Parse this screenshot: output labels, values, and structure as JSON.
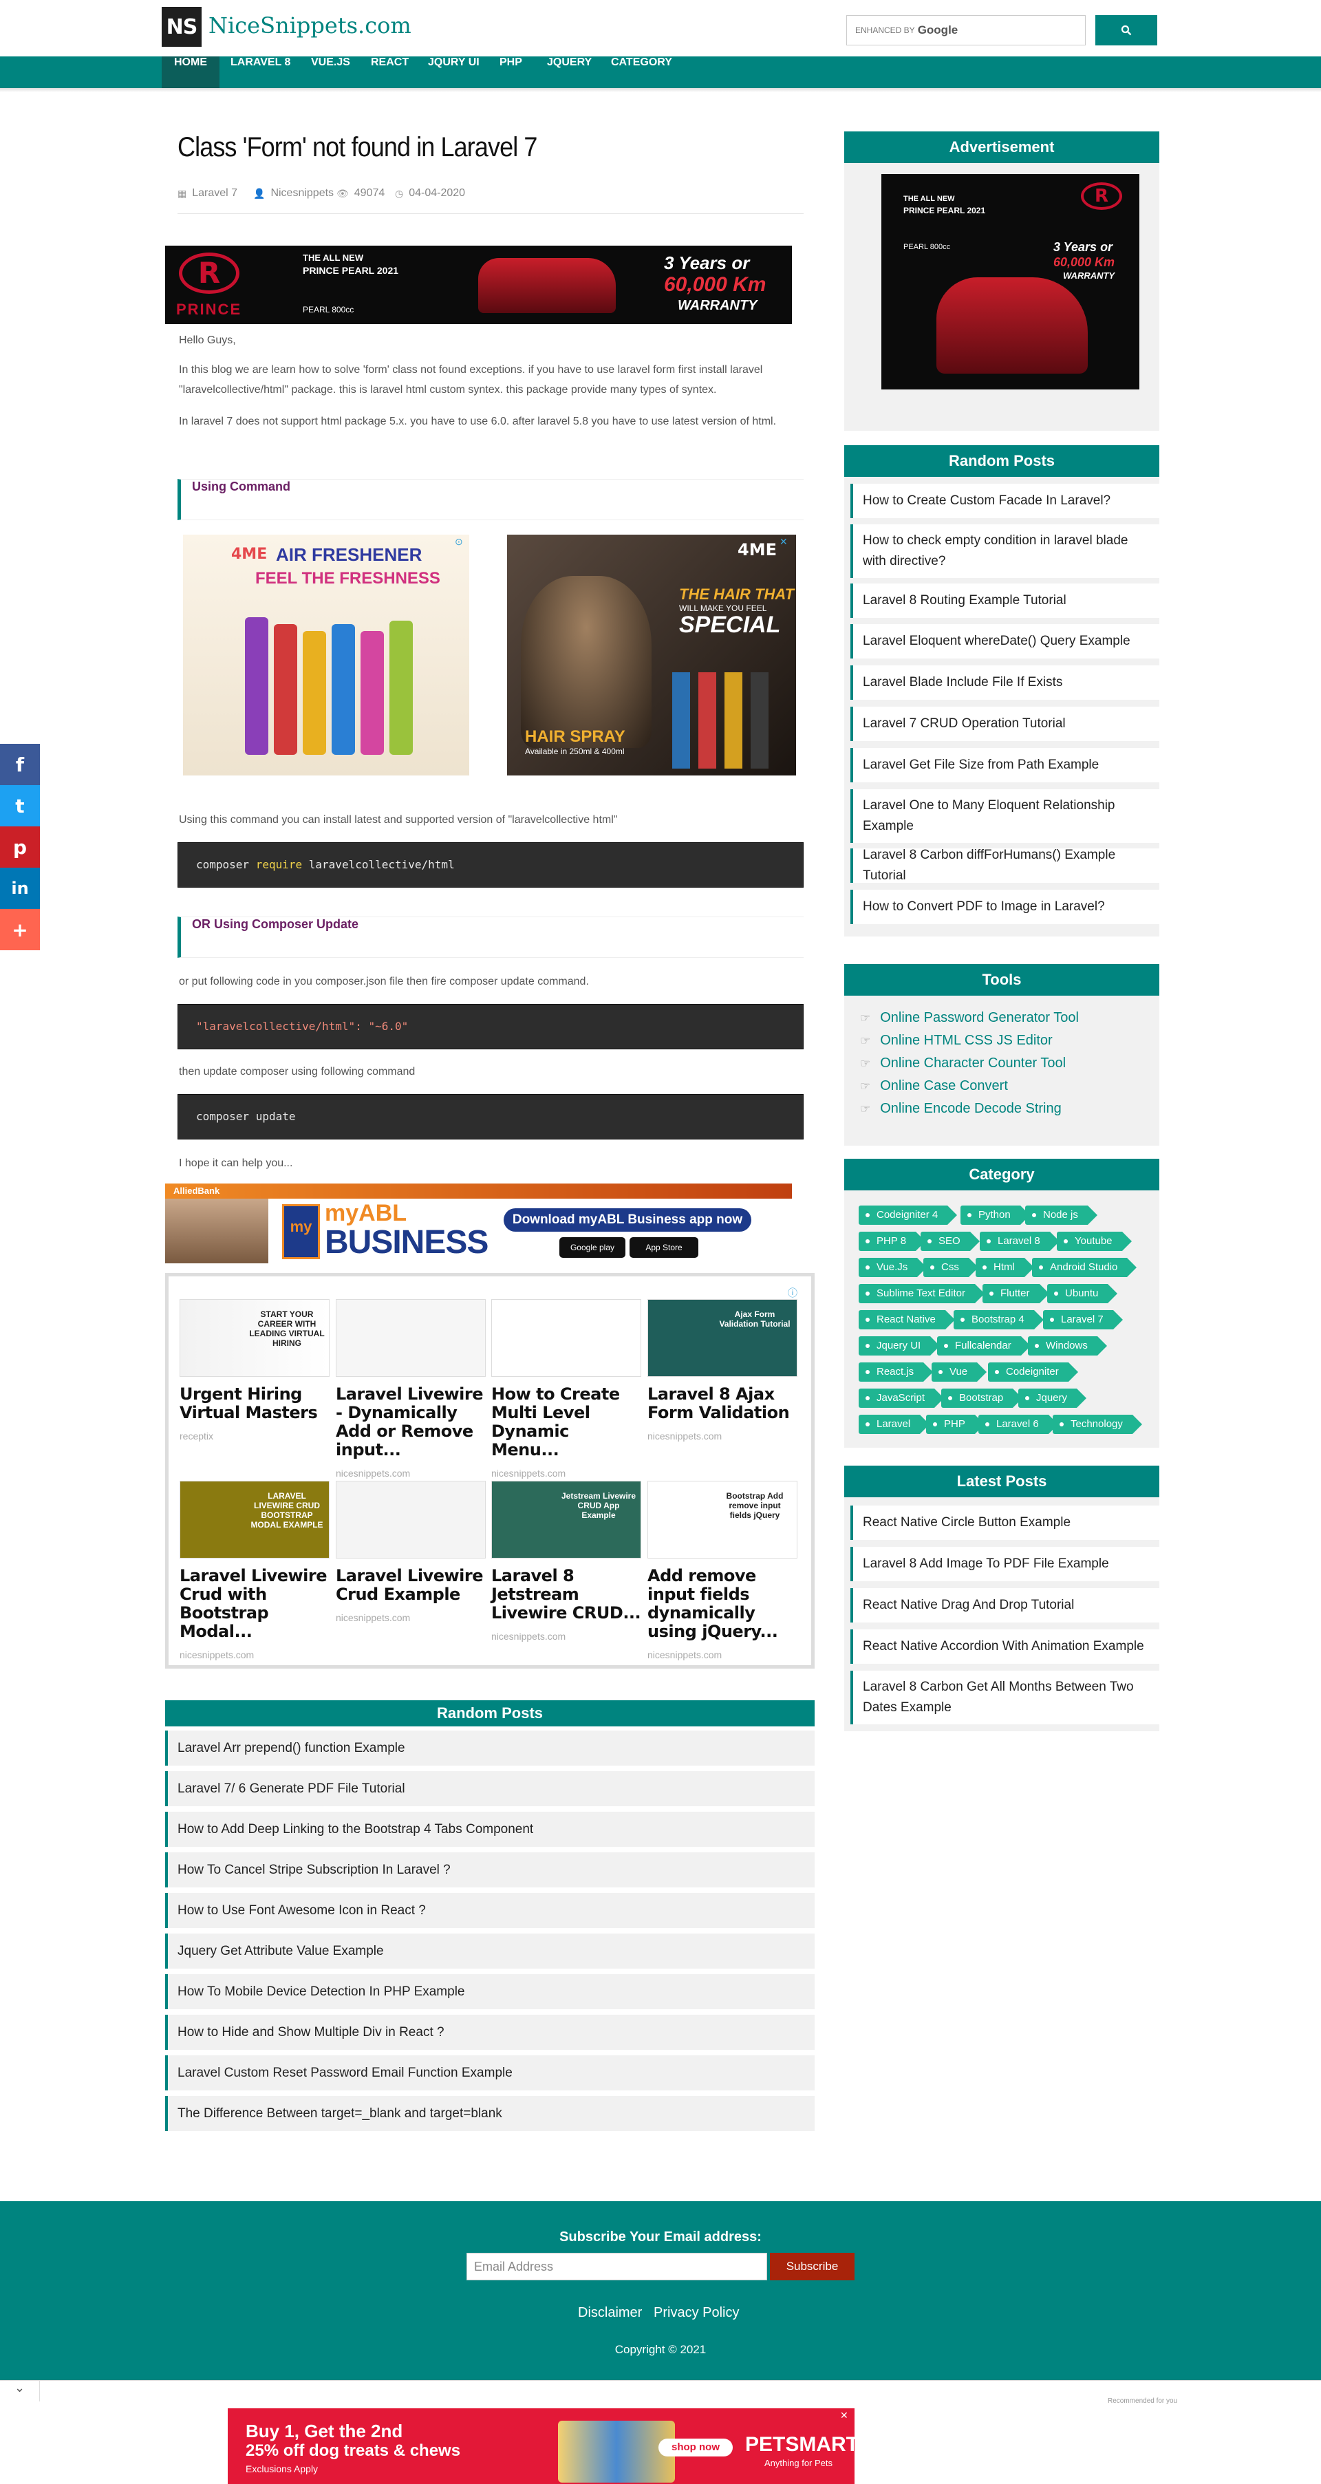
{
  "header": {
    "logo_mark": "NS",
    "site_name": "NiceSnippets.com",
    "search_prefix": "ENHANCED BY",
    "search_brand": "Google"
  },
  "nav": [
    "HOME",
    "LARAVEL 8",
    "VUE.JS",
    "REACT",
    "JQURY UI",
    "PHP",
    "JQUERY",
    "CATEGORY"
  ],
  "article": {
    "title": "Class 'Form' not found in Laravel 7",
    "meta": {
      "category": "Laravel 7",
      "author": "Nicesnippets",
      "views": "49074",
      "date": "04-04-2020"
    },
    "p1": "Hello Guys,",
    "p2": "In this blog we are learn how to solve 'form' class not found exceptions. if you have to use laravel form first install laravel \"laravelcollective/html\" package. this is laravel html custom syntex. this package provide many types of syntex.",
    "p3": "In laravel 7 does not support html package 5.x. you have to use 6.0. after laravel 5.8 you have to use latest version of html.",
    "section1": "Using Command",
    "p4": "Using this command you can install latest and supported version of \"laravelcollective html\"",
    "code1_a": "composer ",
    "code1_kw": "require",
    "code1_b": " laravelcollective/html",
    "section2": "OR Using Composer Update",
    "p5": "or put following code in you composer.json file then fire composer update command.",
    "code2": "\"laravelcollective/html\": \"~6.0\"",
    "p6": "then update composer using following command",
    "code3": "composer update",
    "p7": "I hope it can help you..."
  },
  "ads": {
    "prince_top": "THE ALL NEW",
    "prince_model": "PRINCE PEARL 2021",
    "prince_price": "PEARL 800cc",
    "prince_warranty1": "3 Years or",
    "prince_warranty2": "60,000 Km",
    "prince_warranty3": "WARRANTY",
    "prince_brand": "PRINCE",
    "air_brand": "4ME",
    "air_title": "AIR FRESHENER",
    "air_sub": "FEEL THE FRESHNESS",
    "hair_brand": "4ME",
    "hair_line1": "THE HAIR THAT",
    "hair_line2": "WILL MAKE YOU FEEL",
    "hair_line3": "SPECIAL",
    "hair_spray": "HAIR SPRAY",
    "hair_avail": "Available in 250ml & 400ml",
    "abl_bank": "AlliedBank",
    "abl_my": "my",
    "abl_name": "myABL",
    "abl_business": "BUSINESS",
    "abl_cta": "Download myABL Business app now",
    "abl_gp": "Google play",
    "abl_as": "App Store",
    "pet_line1": "Buy 1, Get the 2nd",
    "pet_line2": "25% off dog treats & chews",
    "pet_line3": "Exclusions Apply",
    "pet_cta": "shop now",
    "pet_brand": "PETSMART",
    "pet_tag": "Anything for Pets",
    "recommended": "Recommended for you"
  },
  "recommended": [
    {
      "title": "Urgent Hiring Virtual Masters",
      "source": "receptix",
      "thumb": "START YOUR CAREER WITH LEADING VIRTUAL HIRING"
    },
    {
      "title": "Laravel Livewire - Dynamically Add or Remove input...",
      "source": "nicesnippets.com",
      "thumb": ""
    },
    {
      "title": "How to Create Multi Level Dynamic Menu...",
      "source": "nicesnippets.com",
      "thumb": ""
    },
    {
      "title": "Laravel 8 Ajax Form Validation",
      "source": "nicesnippets.com",
      "thumb": "Ajax Form Validation Tutorial"
    },
    {
      "title": "Laravel Livewire Crud with Bootstrap Modal...",
      "source": "nicesnippets.com",
      "thumb": "LARAVEL LIVEWIRE CRUD BOOTSTRAP MODAL EXAMPLE"
    },
    {
      "title": "Laravel Livewire Crud Example",
      "source": "nicesnippets.com",
      "thumb": ""
    },
    {
      "title": "Laravel 8 Jetstream Livewire CRUD...",
      "source": "nicesnippets.com",
      "thumb": "Jetstream Livewire CRUD App Example"
    },
    {
      "title": "Add remove input fields dynamically using jQuery...",
      "source": "nicesnippets.com",
      "thumb": "Bootstrap Add remove input fields jQuery"
    }
  ],
  "bottom_random": {
    "title": "Random Posts",
    "items": [
      "Laravel Arr prepend() function Example",
      "Laravel 7/ 6 Generate PDF File Tutorial",
      "How to Add Deep Linking to the Bootstrap 4 Tabs Component",
      "How To Cancel Stripe Subscription In Laravel ?",
      "How to Use Font Awesome Icon in React ?",
      "Jquery Get Attribute Value Example",
      "How To Mobile Device Detection In PHP Example",
      "How to Hide and Show Multiple Div in React ?",
      "Laravel Custom Reset Password Email Function Example",
      "The Difference Between target=_blank and target=blank"
    ]
  },
  "sidebar": {
    "ad_title": "Advertisement",
    "random_title": "Random Posts",
    "random": [
      "How to Create Custom Facade In Laravel?",
      "How to check empty condition in laravel blade with directive?",
      "Laravel 8 Routing Example Tutorial",
      "Laravel Eloquent whereDate() Query Example",
      "Laravel Blade Include File If Exists",
      "Laravel 7 CRUD Operation Tutorial",
      "Laravel Get File Size from Path Example",
      "Laravel One to Many Eloquent Relationship Example",
      "Laravel 8 Carbon diffForHumans() Example Tutorial",
      "How to Convert PDF to Image in Laravel?"
    ],
    "tools_title": "Tools",
    "tools": [
      "Online Password Generator Tool",
      "Online HTML CSS JS Editor",
      "Online Character Counter Tool",
      "Online Case Convert",
      "Online Encode Decode String"
    ],
    "category_title": "Category",
    "categories": [
      "Codeigniter 4",
      "Python",
      "Node js",
      "PHP 8",
      "SEO",
      "Laravel 8",
      "Youtube",
      "Vue.Js",
      "Css",
      "Html",
      "Android Studio",
      "Sublime Text Editor",
      "Flutter",
      "Ubuntu",
      "React Native",
      "Bootstrap 4",
      "Laravel 7",
      "Jquery UI",
      "Fullcalendar",
      "Windows",
      "React.js",
      "Vue",
      "Codeigniter",
      "JavaScript",
      "Bootstrap",
      "Jquery",
      "Laravel",
      "PHP",
      "Laravel 6",
      "Technology"
    ],
    "latest_title": "Latest Posts",
    "latest": [
      "React Native Circle Button Example",
      "Laravel 8 Add Image To PDF File Example",
      "React Native Drag And Drop Tutorial",
      "React Native Accordion With Animation Example",
      "Laravel 8 Carbon Get All Months Between Two Dates Example"
    ]
  },
  "share": [
    "f",
    "t",
    "p",
    "in",
    "+"
  ],
  "footer": {
    "subscribe_title": "Subscribe Your Email address:",
    "email_placeholder": "Email Address",
    "subscribe_button": "Subscribe",
    "disclaimer": "Disclaimer",
    "privacy": "Privacy Policy",
    "copyright": "Copyright © 2021"
  },
  "colors": {
    "brand": "#00847f",
    "tag": "#1fb592",
    "subscribe": "#a8230a"
  }
}
